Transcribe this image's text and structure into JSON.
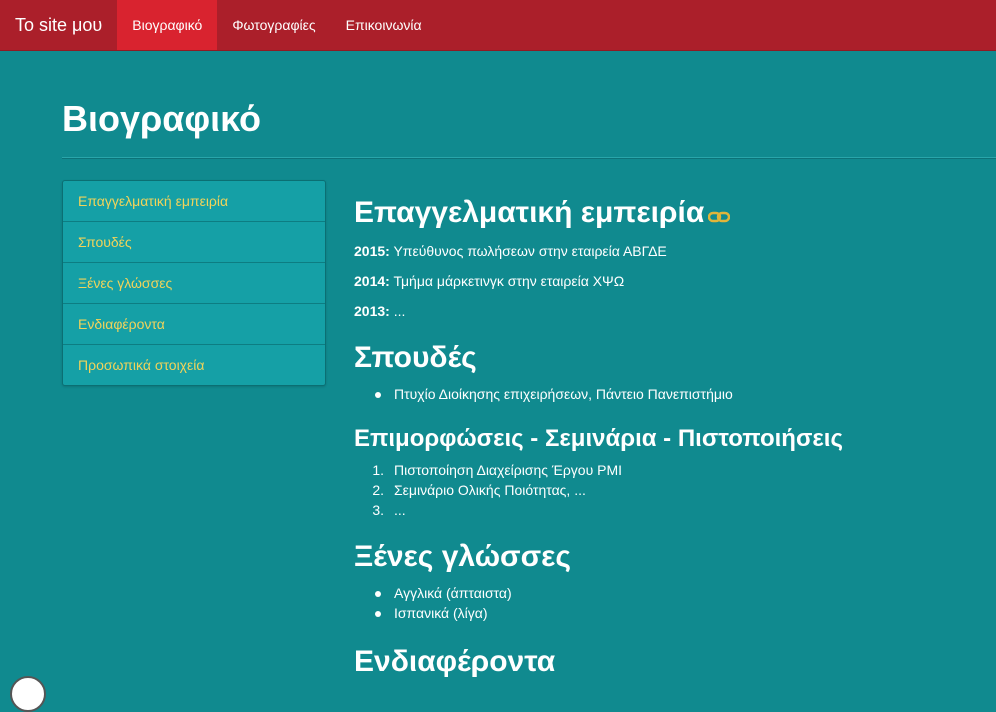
{
  "navbar": {
    "brand": "To site μου",
    "links": [
      "Βιογραφικό",
      "Φωτογραφίες",
      "Επικοινωνία"
    ]
  },
  "page_title": "Βιογραφικό",
  "sidebar": {
    "items": [
      "Επαγγελματική εμπειρία",
      "Σπουδές",
      "Ξένες γλώσσες",
      "Ενδιαφέροντα",
      "Προσωπικά στοιχεία"
    ]
  },
  "experience": {
    "heading": "Επαγγελματική εμπειρία",
    "entries": [
      {
        "year": "2015:",
        "text": " Υπεύθυνος πωλήσεων στην εταιρεία ΑΒΓΔΕ"
      },
      {
        "year": "2014:",
        "text": " Τμήμα μάρκετινγκ στην εταιρεία ΧΨΩ"
      },
      {
        "year": "2013:",
        "text": " ..."
      }
    ]
  },
  "studies": {
    "heading": "Σπουδές",
    "items": [
      "Πτυχίο Διοίκησης επιχειρήσεων, Πάντειο Πανεπιστήμιο"
    ]
  },
  "seminars": {
    "heading": "Επιμορφώσεις - Σεμινάρια - Πιστοποιήσεις",
    "numbers": [
      "1.",
      "2.",
      "3."
    ],
    "items": [
      "Πιστοποίηση Διαχείρισης Έργου PMI",
      "Σεμινάριο Ολικής Ποιότητας, ...",
      "..."
    ]
  },
  "languages": {
    "heading": "Ξένες γλώσσες",
    "items": [
      "Αγγλικά (άπταιστα)",
      "Ισπανικά (λίγα)"
    ]
  },
  "interests": {
    "heading": "Ενδιαφέροντα"
  },
  "colors": {
    "navbar": "#ab1f2a",
    "nav_active": "#d9232f",
    "background": "#108a8f",
    "sidebar_link": "#f1d35a"
  }
}
